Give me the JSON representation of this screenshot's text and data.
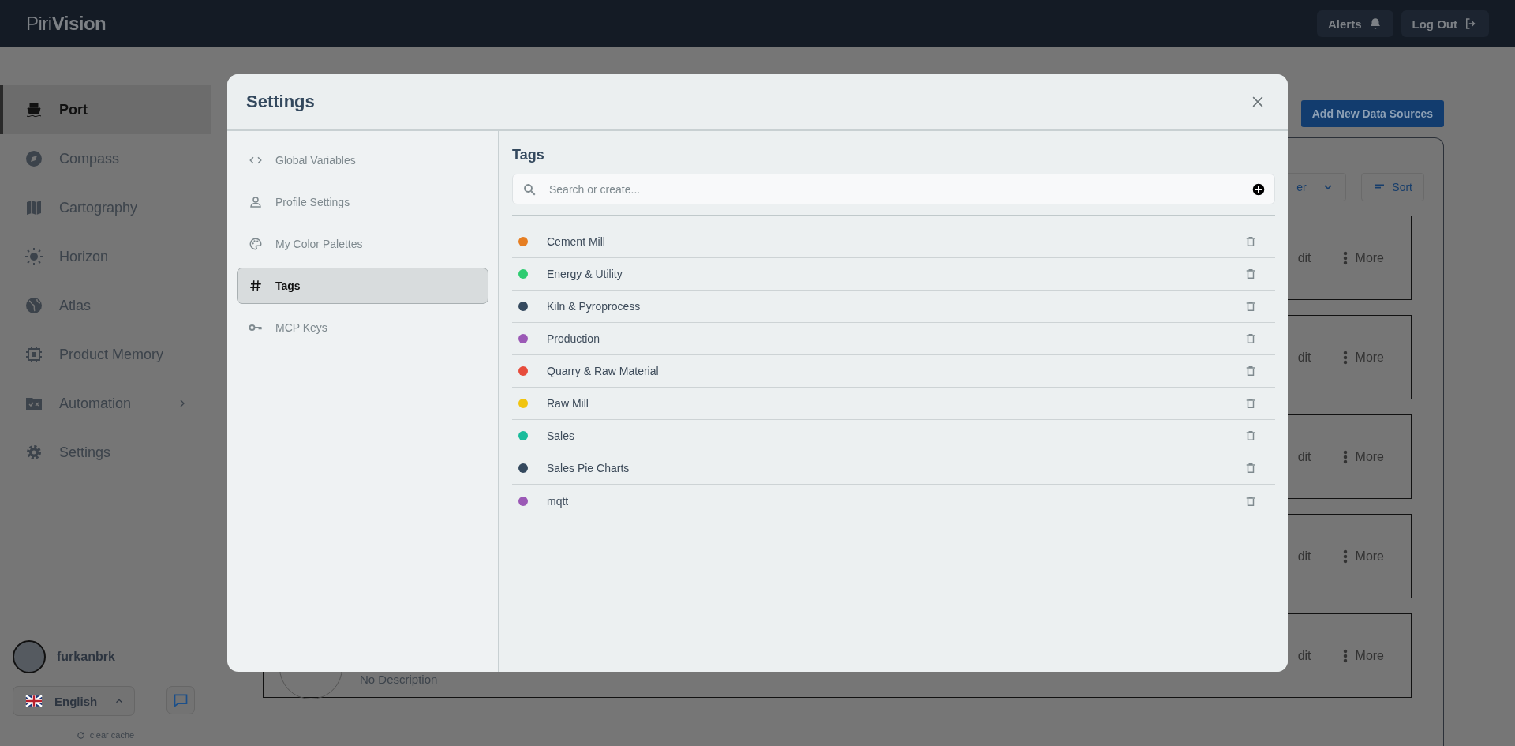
{
  "header": {
    "logo": "Piri**Vision**",
    "buttons": [
      {
        "label": "Alerts"
      },
      {
        "label": "Log Out"
      }
    ]
  },
  "sidebar": {
    "items": [
      {
        "label": "Port",
        "selected": true,
        "has_submenu": false
      },
      {
        "label": "Compass",
        "selected": false,
        "has_submenu": false
      },
      {
        "label": "Cartography",
        "selected": false,
        "has_submenu": false
      },
      {
        "label": "Horizon",
        "selected": false,
        "has_submenu": false
      },
      {
        "label": "Atlas",
        "selected": false,
        "has_submenu": false
      },
      {
        "label": "Product Memory",
        "selected": false,
        "has_submenu": false
      },
      {
        "label": "Automation",
        "selected": false,
        "has_submenu": true
      },
      {
        "label": "Settings",
        "selected": false,
        "has_submenu": false
      }
    ],
    "user": {
      "name": "furkanbrk"
    },
    "language": {
      "label": "English"
    },
    "clear_cache": "clear cache"
  },
  "main": {
    "add_button": "Add New Data Sources",
    "filter": {
      "value": "er"
    },
    "sort_button": "Sort",
    "cards": [
      {
        "edit": "dit",
        "more": "More"
      },
      {
        "edit": "dit",
        "more": "More"
      },
      {
        "edit": "dit",
        "more": "More"
      },
      {
        "edit": "dit",
        "more": "More"
      },
      {
        "edit": "dit",
        "more": "More",
        "description": "No Description"
      }
    ]
  },
  "modal": {
    "title": "Settings",
    "nav": [
      {
        "label": "Global Variables",
        "selected": false
      },
      {
        "label": "Profile Settings",
        "selected": false
      },
      {
        "label": "My Color Palettes",
        "selected": false
      },
      {
        "label": "Tags",
        "selected": true
      },
      {
        "label": "MCP Keys",
        "selected": false
      }
    ],
    "tags": {
      "title": "Tags",
      "search": {
        "placeholder": "Search or create..."
      },
      "items": [
        {
          "label": "Cement Mill",
          "color": "#e67e22"
        },
        {
          "label": "Energy & Utility",
          "color": "#2ecc71"
        },
        {
          "label": "Kiln & Pyroprocess",
          "color": "#34495e"
        },
        {
          "label": "Production",
          "color": "#9b59b6"
        },
        {
          "label": "Quarry & Raw Material",
          "color": "#e74c3c"
        },
        {
          "label": "Raw Mill",
          "color": "#f1c40f"
        },
        {
          "label": "Sales",
          "color": "#1abc9c"
        },
        {
          "label": "Sales Pie Charts",
          "color": "#34495e"
        },
        {
          "label": "mqtt",
          "color": "#9b59b6"
        }
      ]
    }
  }
}
